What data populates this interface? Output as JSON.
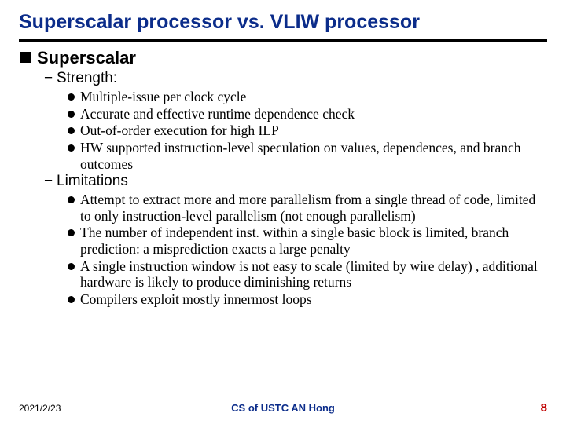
{
  "title": "Superscalar processor vs. VLIW processor",
  "section1": {
    "heading": "Superscalar",
    "sub1": "Strength:",
    "strength_items": [
      "Multiple-issue per clock cycle",
      "Accurate and effective runtime dependence check",
      "Out-of-order execution for high ILP",
      "HW supported instruction-level  speculation on values, dependences, and branch outcomes"
    ],
    "sub2": "Limitations",
    "limitation_items": [
      "Attempt to extract more and more parallelism from a single thread of code, limited to only instruction-level parallelism (not enough parallelism)",
      "The number of independent inst. within a single basic block is limited, branch prediction: a misprediction exacts a large penalty",
      "A single instruction window is not easy to scale (limited by wire delay) , additional hardware is likely to produce diminishing returns",
      "Compilers exploit  mostly innermost loops"
    ]
  },
  "footer": {
    "date": "2021/2/23",
    "center": "CS of USTC AN Hong",
    "page": "8"
  }
}
